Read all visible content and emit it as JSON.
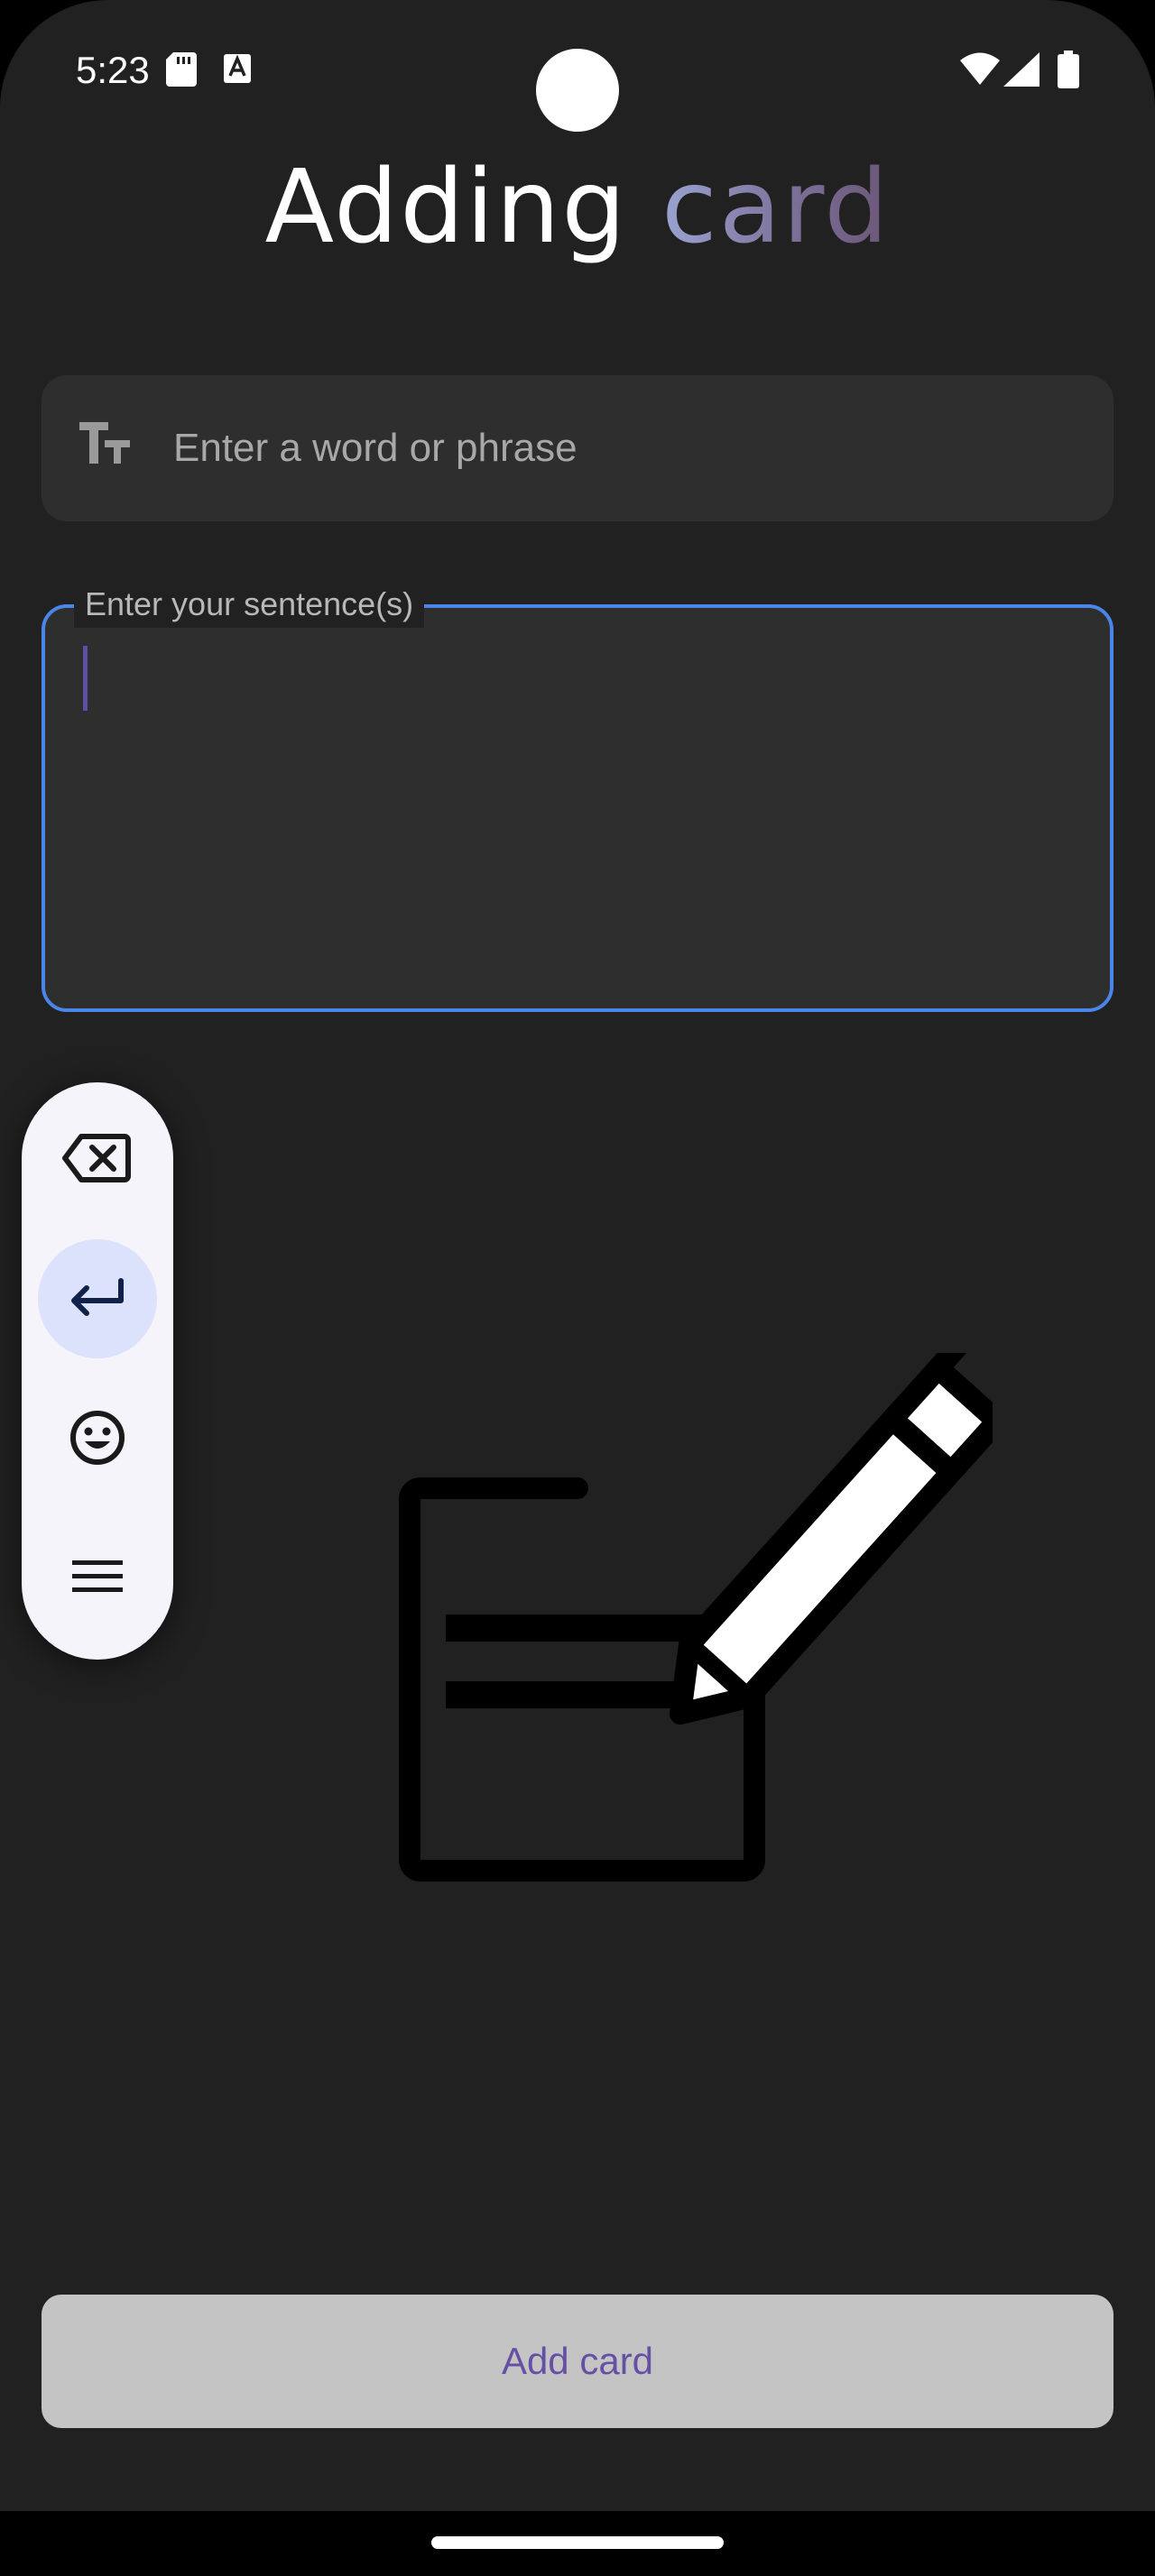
{
  "status_bar": {
    "time": "5:23",
    "icons": [
      "sd-card-icon",
      "text-a-icon",
      "wifi-icon",
      "cell-signal-icon",
      "battery-icon"
    ]
  },
  "header": {
    "title_main": "Adding ",
    "title_accent": "card"
  },
  "word_input": {
    "icon": "text-size-icon",
    "placeholder": "Enter a word or phrase",
    "value": ""
  },
  "sentence_input": {
    "label": "Enter your sentence(s)",
    "value": "",
    "focused": true
  },
  "keyboard_toolbar": {
    "items": [
      {
        "name": "backspace-icon"
      },
      {
        "name": "enter-icon",
        "active": true
      },
      {
        "name": "emoji-icon"
      },
      {
        "name": "menu-icon"
      }
    ]
  },
  "illustration": {
    "name": "document-pencil-icon"
  },
  "footer": {
    "add_button_label": "Add card"
  },
  "colors": {
    "background": "#212121",
    "field": "#2e2e2e",
    "focus_border": "#4a86e8",
    "button": "#c4c4c4",
    "button_text": "#6750a4",
    "toolbar": "#f5f4fb",
    "toolbar_active": "#dce2fb"
  }
}
